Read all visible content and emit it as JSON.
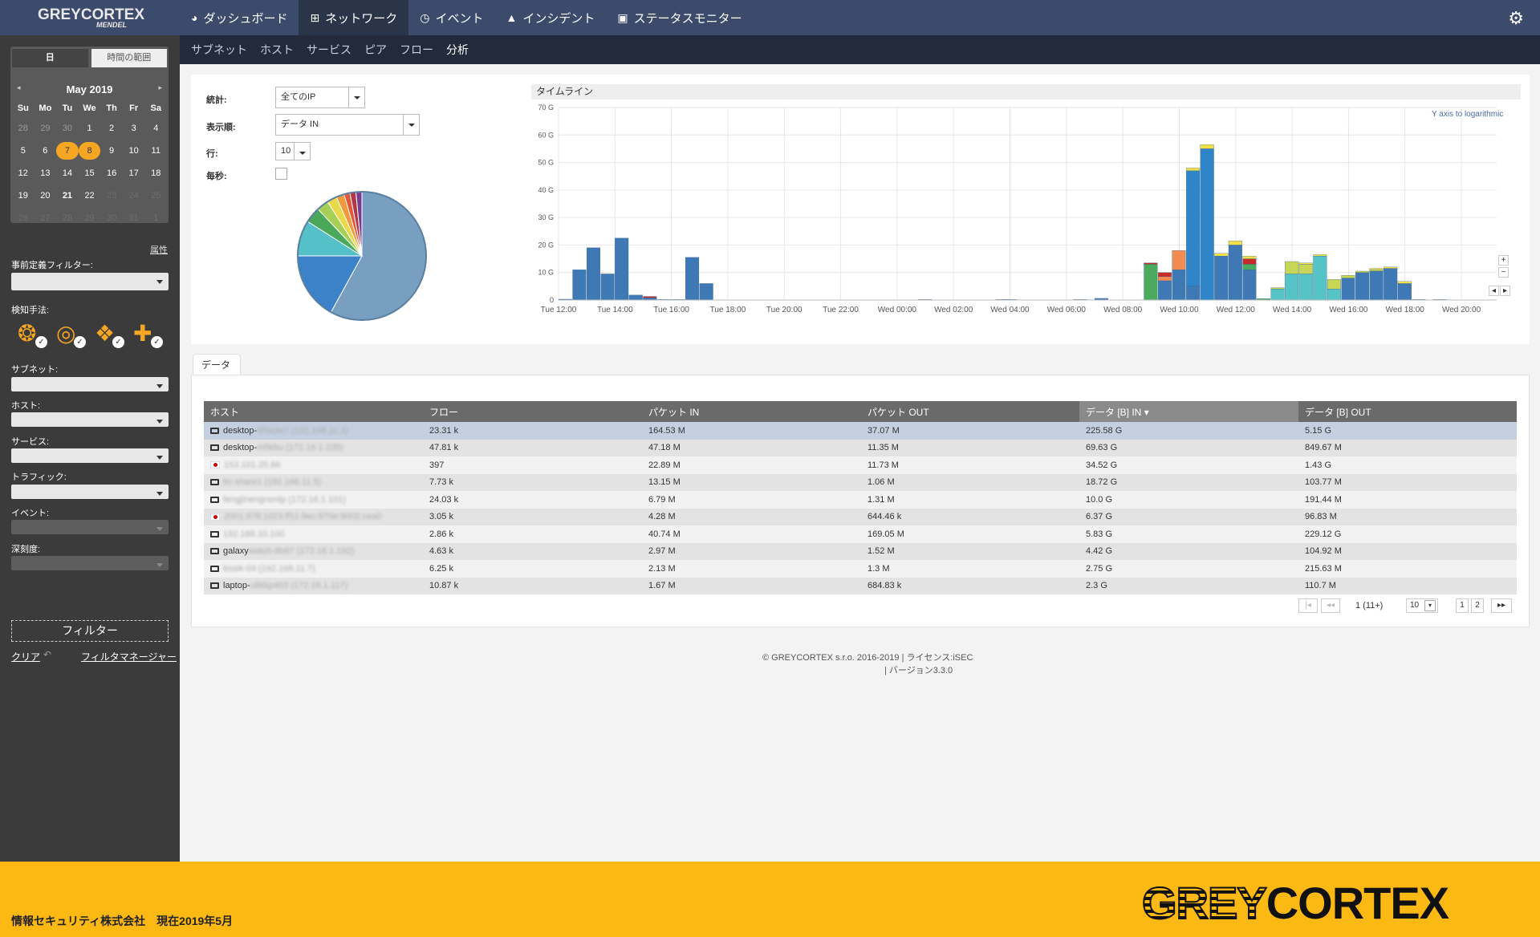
{
  "app": {
    "logo_main": "GREYCORTEX",
    "logo_sub": "MENDEL"
  },
  "nav": [
    {
      "label": "ダッシュボード",
      "icon": "pie-icon"
    },
    {
      "label": "ネットワーク",
      "icon": "sitemap-icon"
    },
    {
      "label": "イベント",
      "icon": "clock-icon"
    },
    {
      "label": "インシデント",
      "icon": "warning-icon"
    },
    {
      "label": "ステータスモニター",
      "icon": "medkit-icon"
    }
  ],
  "subnav": [
    "サブネット",
    "ホスト",
    "サービス",
    "ピア",
    "フロー",
    "分析"
  ],
  "calendar": {
    "tab_day": "日",
    "tab_range": "時間の範囲",
    "month": "May 2019",
    "prev": "◂",
    "next": "▸",
    "dow": [
      "Su",
      "Mo",
      "Tu",
      "We",
      "Th",
      "Fr",
      "Sa"
    ],
    "weeks": [
      [
        "28",
        "29",
        "30",
        "1",
        "2",
        "3",
        "4"
      ],
      [
        "5",
        "6",
        "7",
        "8",
        "9",
        "10",
        "11"
      ],
      [
        "12",
        "13",
        "14",
        "15",
        "16",
        "17",
        "18"
      ],
      [
        "19",
        "20",
        "21",
        "22",
        "23",
        "24",
        "25"
      ],
      [
        "26",
        "27",
        "28",
        "29",
        "30",
        "31",
        "1"
      ]
    ]
  },
  "sidebar": {
    "attr_link": "属性",
    "predef_label": "事前定義フィルター:",
    "methods_label": "検知手法:",
    "subnet_label": "サブネット:",
    "host_label": "ホスト:",
    "service_label": "サービス:",
    "traffic_label": "トラフィック:",
    "event_label": "イベント:",
    "severity_label": "深刻度:",
    "filter_button": "フィルター",
    "clear_link": "クリア",
    "fm_link": "フィルタマネージャー"
  },
  "stats": {
    "stat_label": "統計:",
    "stat_value": "全てのIP",
    "order_label": "表示順:",
    "order_value": "データ IN",
    "rows_label": "行:",
    "rows_value": "10",
    "persec_label": "毎秒:"
  },
  "colors": {
    "accent": "#f5a623",
    "topbar": "#3c4a6b",
    "subnav": "#222a3b",
    "brand": "#fcb813"
  },
  "timeline": {
    "title": "タイムライン",
    "log_toggle": "Y axis to logarithmic"
  },
  "chart_data": [
    {
      "type": "pie",
      "values": [
        58,
        17,
        9,
        4,
        3,
        2.5,
        2,
        1.5,
        1.5,
        1.5
      ],
      "colors": [
        "#789fc0",
        "#3b82c9",
        "#55c0c8",
        "#4aa85a",
        "#a7cf55",
        "#e8d94a",
        "#f29a3b",
        "#e3573b",
        "#b0384a",
        "#7d3a8c"
      ]
    },
    {
      "type": "bar",
      "stacked": true,
      "ylabels": [
        "0",
        "10 G",
        "20 G",
        "30 G",
        "40 G",
        "50 G",
        "60 G",
        "70 G"
      ],
      "ylim": [
        0,
        70
      ],
      "xlabels": [
        "Tue 12:00",
        "Tue 14:00",
        "Tue 16:00",
        "Tue 18:00",
        "Tue 20:00",
        "Tue 22:00",
        "Wed 00:00",
        "Wed 02:00",
        "Wed 04:00",
        "Wed 06:00",
        "Wed 08:00",
        "Wed 10:00",
        "Wed 12:00",
        "Wed 14:00",
        "Wed 16:00",
        "Wed 18:00",
        "Wed 20:00"
      ],
      "xlim": [
        0,
        66.5
      ],
      "series_colors": [
        "#3f79b5",
        "#2f85c8",
        "#56c3c6",
        "#4aab5d",
        "#c7d654",
        "#f08c52",
        "#c82a2a",
        "#f2e04a"
      ],
      "bars": [
        {
          "x": 0,
          "s": [
            0.3
          ]
        },
        {
          "x": 1,
          "s": [
            11
          ]
        },
        {
          "x": 2,
          "s": [
            19
          ]
        },
        {
          "x": 3,
          "s": [
            9.5
          ]
        },
        {
          "x": 4,
          "s": [
            22.5
          ]
        },
        {
          "x": 5,
          "s": [
            1.8
          ]
        },
        {
          "x": 6,
          "s": [
            0.8,
            0,
            0,
            0,
            0,
            0,
            0.5
          ]
        },
        {
          "x": 7,
          "s": [
            0.2
          ]
        },
        {
          "x": 8,
          "s": [
            0.2
          ]
        },
        {
          "x": 9,
          "s": [
            15.5
          ]
        },
        {
          "x": 10,
          "s": [
            6
          ]
        },
        {
          "x": 25.5,
          "s": [
            0.2
          ]
        },
        {
          "x": 31,
          "s": [
            0.2
          ]
        },
        {
          "x": 31.5,
          "s": [
            0.2
          ]
        },
        {
          "x": 36.5,
          "s": [
            0.2
          ]
        },
        {
          "x": 38,
          "s": [
            0.6
          ]
        },
        {
          "x": 41.5,
          "s": [
            0,
            0,
            0,
            13,
            0,
            0,
            0.5
          ]
        },
        {
          "x": 42.5,
          "s": [
            7,
            0,
            0,
            0,
            0,
            1.5,
            1.5
          ]
        },
        {
          "x": 43.5,
          "s": [
            11,
            0,
            0,
            0,
            0,
            7,
            0,
            0
          ]
        },
        {
          "x": 44.5,
          "s": [
            5,
            42,
            0,
            0,
            0,
            0,
            0,
            1
          ]
        },
        {
          "x": 45.5,
          "s": [
            0,
            55,
            0,
            0,
            0,
            0,
            0,
            1.5
          ]
        },
        {
          "x": 46.5,
          "s": [
            16,
            0,
            0,
            0,
            0,
            0,
            0,
            1
          ]
        },
        {
          "x": 47.5,
          "s": [
            20,
            0,
            0,
            0,
            0,
            0,
            0,
            1.5
          ]
        },
        {
          "x": 48.5,
          "s": [
            11,
            0,
            0,
            2,
            0,
            0,
            2,
            1
          ]
        },
        {
          "x": 49.5,
          "s": [
            0,
            0,
            0,
            0.5
          ]
        },
        {
          "x": 50.5,
          "s": [
            0,
            0,
            4,
            0,
            0.5
          ]
        },
        {
          "x": 51.5,
          "s": [
            0,
            0,
            9.5,
            0,
            4.5
          ]
        },
        {
          "x": 52.5,
          "s": [
            0,
            0,
            9.5,
            0,
            3.5,
            0,
            0,
            0.5
          ]
        },
        {
          "x": 53.5,
          "s": [
            0,
            0,
            16,
            0,
            0,
            0,
            0,
            0.5
          ]
        },
        {
          "x": 54.5,
          "s": [
            0,
            0,
            4,
            0,
            3.5
          ]
        },
        {
          "x": 55.5,
          "s": [
            8,
            0,
            0,
            0,
            1
          ]
        },
        {
          "x": 56.5,
          "s": [
            10,
            0,
            0,
            0,
            0.5
          ]
        },
        {
          "x": 57.5,
          "s": [
            10.5,
            0,
            0,
            0,
            0.5,
            0,
            0,
            0.5
          ]
        },
        {
          "x": 58.5,
          "s": [
            11.5,
            0,
            0,
            0,
            0,
            0,
            0,
            0.5
          ]
        },
        {
          "x": 59.5,
          "s": [
            6,
            0,
            0,
            0,
            0,
            0,
            0,
            0.8
          ]
        },
        {
          "x": 60.5,
          "s": [
            0.2
          ]
        },
        {
          "x": 62,
          "s": [
            0.2
          ]
        }
      ]
    }
  ],
  "data_tab": "データ",
  "table": {
    "headers": [
      "ホスト",
      "フロー",
      "パケット IN",
      "パケット OUT",
      "データ [B] IN",
      "データ [B] OUT"
    ],
    "rows": [
      {
        "icon": "pc",
        "name": "desktop-",
        "blur": "6f3a3e7 (192.168.11.3)",
        "flows": "23.31 k",
        "pin": "164.53 M",
        "pout": "37.07 M",
        "din": "225.58 G",
        "dout": "5.15 G"
      },
      {
        "icon": "pc",
        "name": "desktop-",
        "blur": "m5kbu (172.16.1.235)",
        "flows": "47.81 k",
        "pin": "47.18 M",
        "pout": "11.35 M",
        "din": "69.63 G",
        "dout": "849.67 M"
      },
      {
        "icon": "flag",
        "name": "",
        "blur": "153.101.25.86",
        "flows": "397",
        "pin": "22.89 M",
        "pout": "11.73 M",
        "din": "34.52 G",
        "dout": "1.43 G"
      },
      {
        "icon": "pc",
        "name": "",
        "blur": "lin-share1 (192.168.11.5)",
        "flows": "7.73 k",
        "pin": "13.15 M",
        "pout": "1.06 M",
        "din": "18.72 G",
        "dout": "103.77 M"
      },
      {
        "icon": "pc",
        "name": "",
        "blur": "fengjinengnontp (172.16.1.101)",
        "flows": "24.03 k",
        "pin": "6.79 M",
        "pout": "1.31 M",
        "din": "10.0 G",
        "dout": "191.44 M"
      },
      {
        "icon": "flag",
        "name": "",
        "blur": "2001:378:1023:ff11:9ec:970e:9002:cea0",
        "flows": "3.05 k",
        "pin": "4.28 M",
        "pout": "644.46 k",
        "din": "6.37 G",
        "dout": "96.83 M"
      },
      {
        "icon": "pc",
        "name": "",
        "blur": "192.168.10.100",
        "flows": "2.86 k",
        "pin": "40.74 M",
        "pout": "169.05 M",
        "din": "5.83 G",
        "dout": "229.12 G"
      },
      {
        "icon": "pc",
        "name": "galaxy",
        "blur": "watch-8b97 (172.16.1.192)",
        "flows": "4.63 k",
        "pin": "2.97 M",
        "pout": "1.52 M",
        "din": "4.42 G",
        "dout": "104.92 M"
      },
      {
        "icon": "pc",
        "name": "",
        "blur": "kiosk-03 (192.168.11.7)",
        "flows": "6.25 k",
        "pin": "2.13 M",
        "pout": "1.3 M",
        "din": "2.75 G",
        "dout": "215.63 M"
      },
      {
        "icon": "pc",
        "name": "laptop-",
        "blur": "u6kkp403 (172.16.1.117)",
        "flows": "10.87 k",
        "pin": "1.67 M",
        "pout": "684.83 k",
        "din": "2.3 G",
        "dout": "110.7 M"
      }
    ]
  },
  "pager": {
    "first": "|◂",
    "prev": "◂◂",
    "info": "1 (11+)",
    "size": "10",
    "p1": "1",
    "p2": "2",
    "next": "▸▸"
  },
  "footer": {
    "line1": "© GREYCORTEX s.r.o. 2016-2019 | ライセンス:iSEC",
    "line2": "| バージョン3.3.0"
  },
  "brand": {
    "company": "情報セキュリティ株式会社　現在2019年5月",
    "logo_a": "GREY",
    "logo_b": "CORTEX"
  }
}
